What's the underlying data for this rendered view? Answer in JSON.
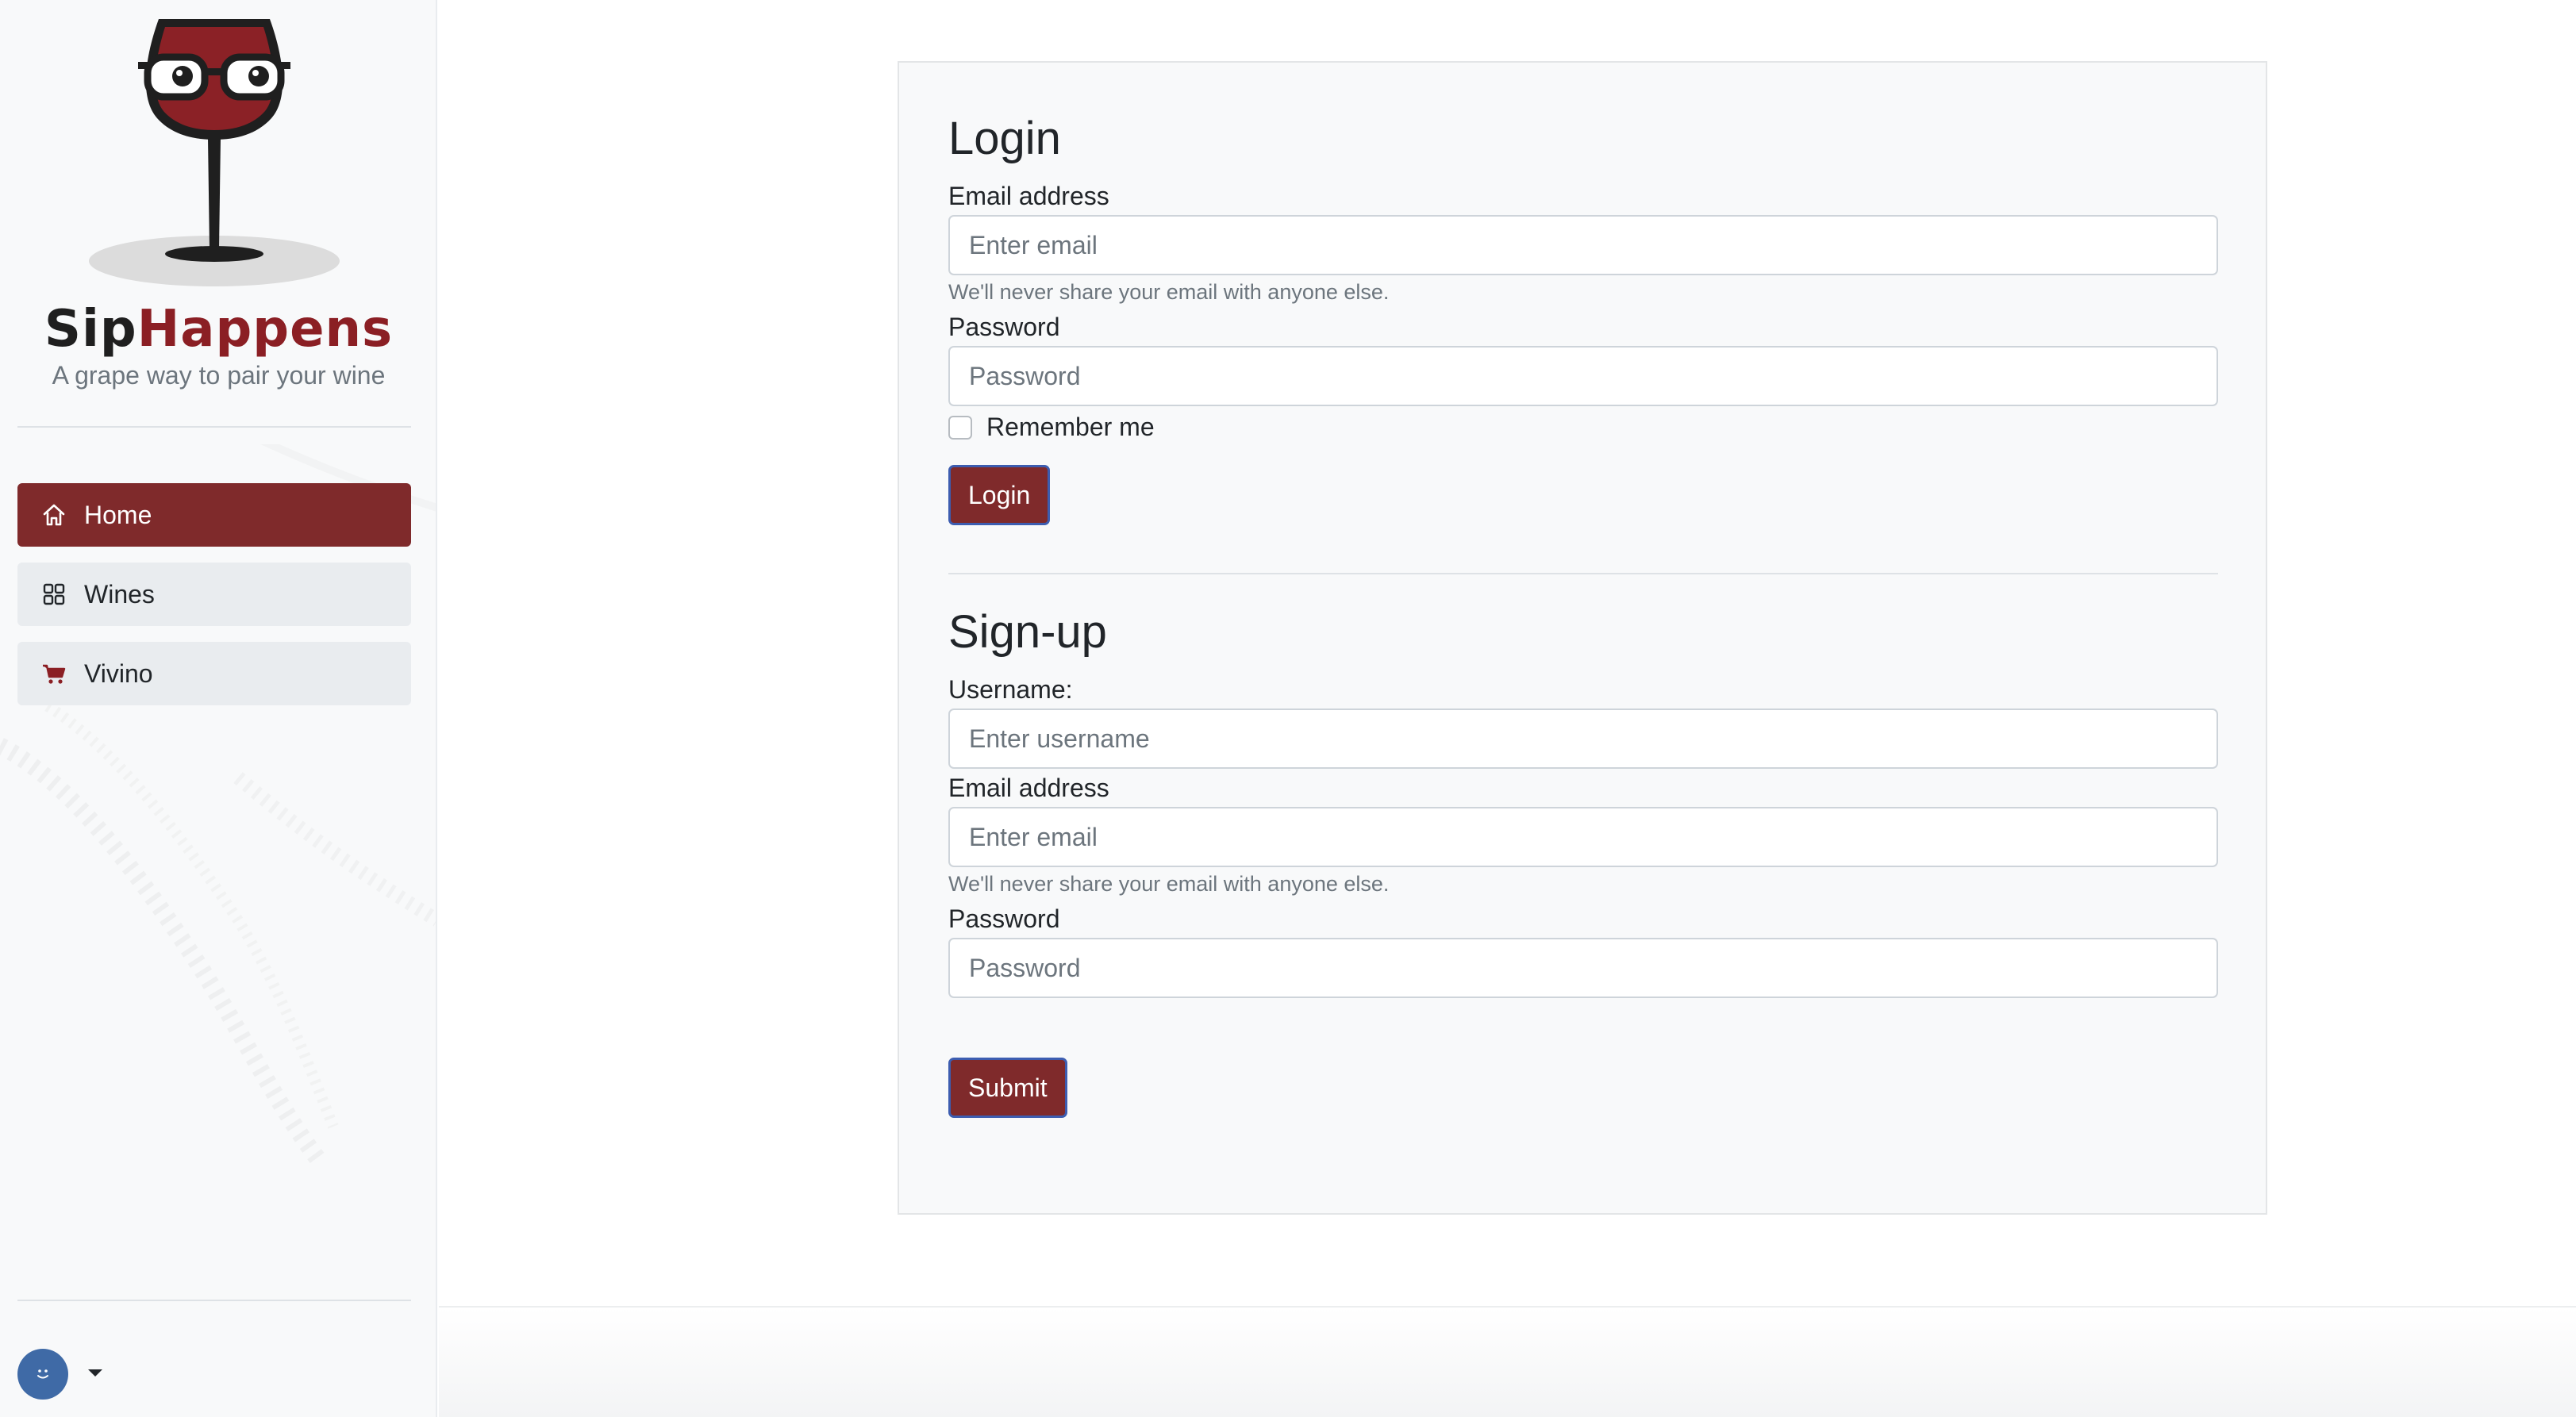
{
  "brand": {
    "name_part1": "Sip",
    "name_part2": "Happens",
    "tagline": "A grape way to pair your wine",
    "primary_color": "#7f2a2b",
    "logo_icon": "wine-glass-with-glasses-icon"
  },
  "sidebar": {
    "items": [
      {
        "label": "Home",
        "icon": "home-icon",
        "active": true
      },
      {
        "label": "Wines",
        "icon": "grid-icon",
        "active": false
      },
      {
        "label": "Vivino",
        "icon": "cart-icon",
        "active": false
      }
    ],
    "user_menu": {
      "icon": "smiley-avatar-icon",
      "caret_icon": "caret-down-icon"
    }
  },
  "login": {
    "title": "Login",
    "email_label": "Email address",
    "email_placeholder": "Enter email",
    "email_help": "We'll never share your email with anyone else.",
    "password_label": "Password",
    "password_placeholder": "Password",
    "remember_label": "Remember me",
    "submit_label": "Login"
  },
  "signup": {
    "title": "Sign-up",
    "username_label": "Username:",
    "username_placeholder": "Enter username",
    "email_label": "Email address",
    "email_placeholder": "Enter email",
    "email_help": "We'll never share your email with anyone else.",
    "password_label": "Password",
    "password_placeholder": "Password",
    "submit_label": "Submit"
  }
}
